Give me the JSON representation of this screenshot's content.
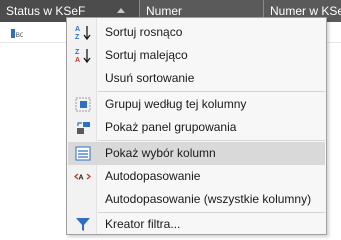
{
  "grid": {
    "columns": [
      {
        "label": "Status w KSeF"
      },
      {
        "label": "Numer"
      },
      {
        "label": "Numer w KSeF"
      }
    ]
  },
  "menu": {
    "items": [
      {
        "label": "Sortuj rosnąco",
        "icon": "sort-ascending-icon"
      },
      {
        "label": "Sortuj malejąco",
        "icon": "sort-descending-icon"
      },
      {
        "label": "Usuń sortowanie",
        "icon": ""
      },
      {
        "label": "Grupuj według tej kolumny",
        "icon": "group-by-column-icon"
      },
      {
        "label": "Pokaż panel grupowania",
        "icon": "group-panel-icon"
      },
      {
        "label": "Pokaż wybór kolumn",
        "icon": "column-chooser-icon",
        "highlighted": true
      },
      {
        "label": "Autodopasowanie",
        "icon": "best-fit-icon"
      },
      {
        "label": "Autodopasowanie (wszystkie kolumny)",
        "icon": ""
      },
      {
        "label": "Kreator filtra...",
        "icon": "filter-icon"
      }
    ]
  }
}
